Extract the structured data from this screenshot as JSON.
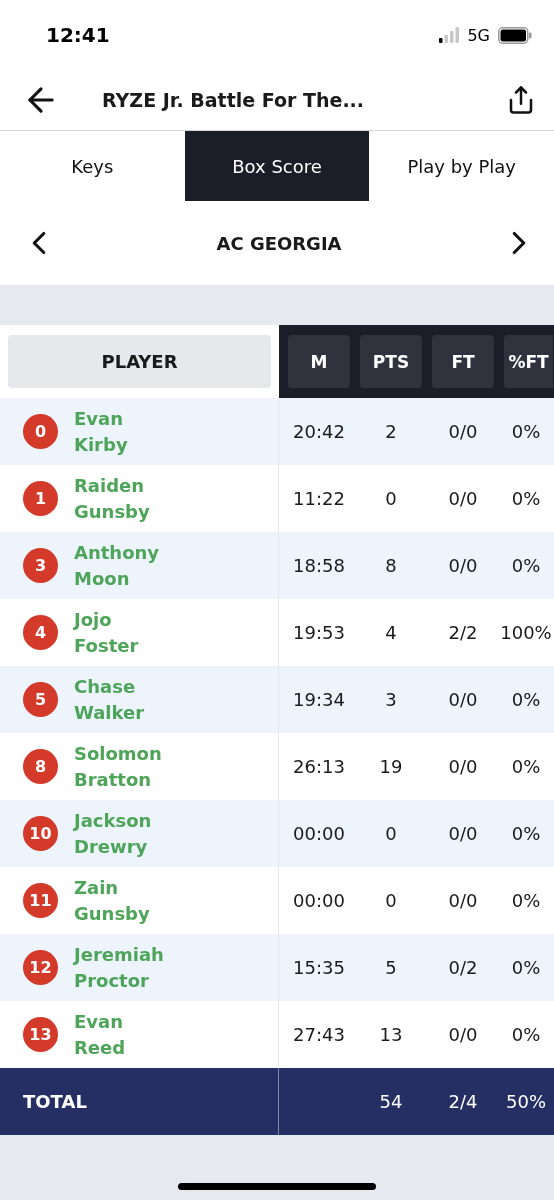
{
  "status_bar": {
    "time": "12:41",
    "network": "5G"
  },
  "header": {
    "title": "RYZE Jr. Battle For The..."
  },
  "tabs": [
    {
      "label": "Keys",
      "selected": false
    },
    {
      "label": "Box Score",
      "selected": true
    },
    {
      "label": "Play by Play",
      "selected": false
    }
  ],
  "team_nav": {
    "team": "AC GEORGIA"
  },
  "table": {
    "player_column": "PLAYER",
    "columns": [
      "M",
      "PTS",
      "FT",
      "%FT"
    ],
    "rows": [
      {
        "number": "0",
        "name": "Evan Kirby",
        "cells": [
          "20:42",
          "2",
          "0/0",
          "0%"
        ]
      },
      {
        "number": "1",
        "name": "Raiden Gunsby",
        "cells": [
          "11:22",
          "0",
          "0/0",
          "0%"
        ]
      },
      {
        "number": "3",
        "name": "Anthony Moon",
        "cells": [
          "18:58",
          "8",
          "0/0",
          "0%"
        ]
      },
      {
        "number": "4",
        "name": "Jojo Foster",
        "cells": [
          "19:53",
          "4",
          "2/2",
          "100%"
        ]
      },
      {
        "number": "5",
        "name": "Chase Walker",
        "cells": [
          "19:34",
          "3",
          "0/0",
          "0%"
        ]
      },
      {
        "number": "8",
        "name": "Solomon Bratton",
        "cells": [
          "26:13",
          "19",
          "0/0",
          "0%"
        ]
      },
      {
        "number": "10",
        "name": "Jackson Drewry",
        "cells": [
          "00:00",
          "0",
          "0/0",
          "0%"
        ]
      },
      {
        "number": "11",
        "name": "Zain Gunsby",
        "cells": [
          "00:00",
          "0",
          "0/0",
          "0%"
        ]
      },
      {
        "number": "12",
        "name": "Jeremiah Proctor",
        "cells": [
          "15:35",
          "5",
          "0/2",
          "0%"
        ]
      },
      {
        "number": "13",
        "name": "Evan Reed",
        "cells": [
          "27:43",
          "13",
          "0/0",
          "0%"
        ]
      }
    ],
    "total": {
      "label": "TOTAL",
      "cells": [
        "",
        "54",
        "2/4",
        "50%"
      ]
    }
  }
}
